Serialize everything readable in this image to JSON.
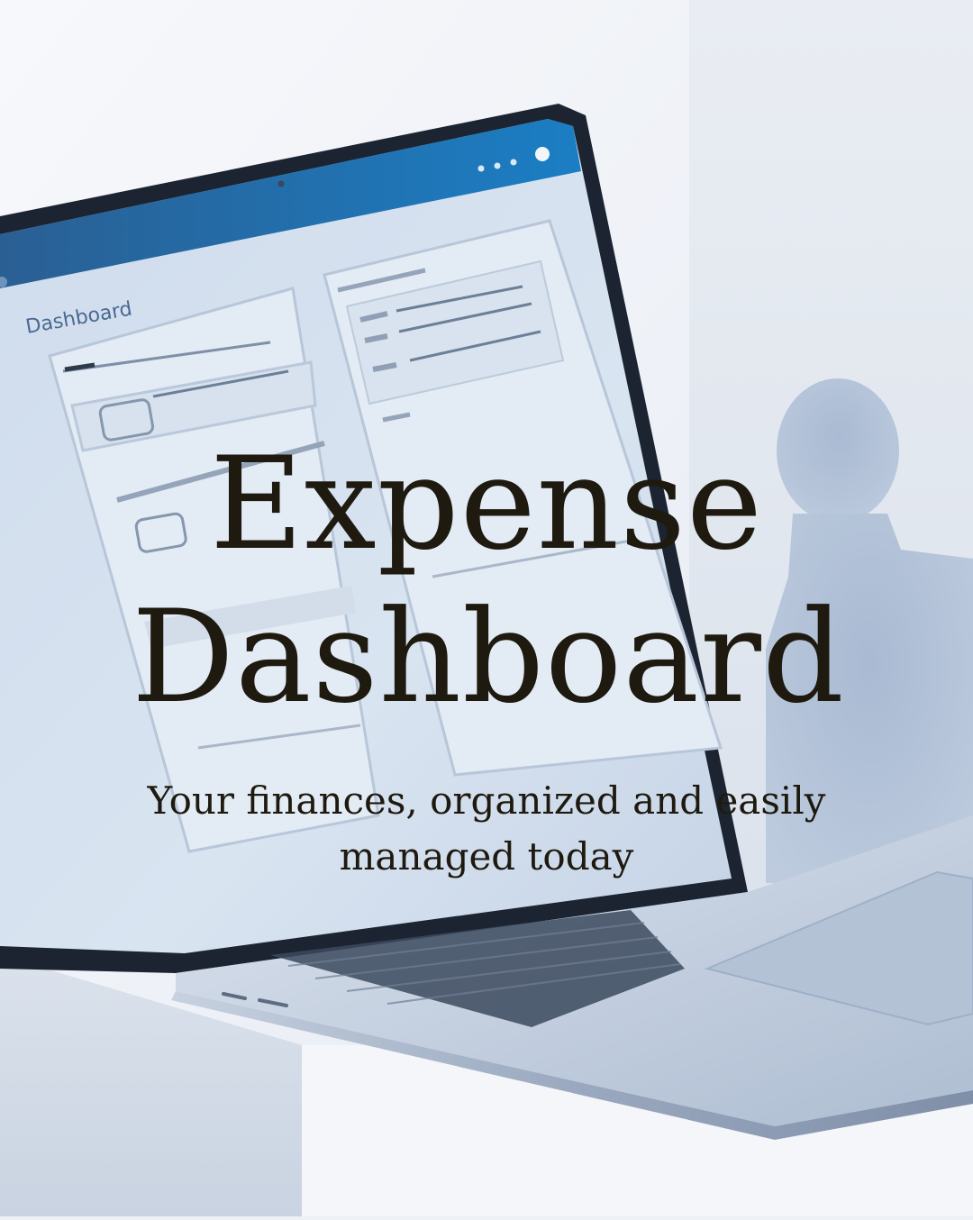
{
  "hero": {
    "title_line_1": "Expense",
    "title_line_2": "Dashboard",
    "subtitle_line_1": "Your finances, organized and easily",
    "subtitle_line_2": "managed today"
  },
  "screen": {
    "label": "Dashboard"
  },
  "colors": {
    "background": "#eef1f6",
    "text": "#1f1a0f",
    "screen_header": "#1b73b3",
    "laptop_body": "#b9c7da",
    "silhouette": "#a8b9d2"
  }
}
